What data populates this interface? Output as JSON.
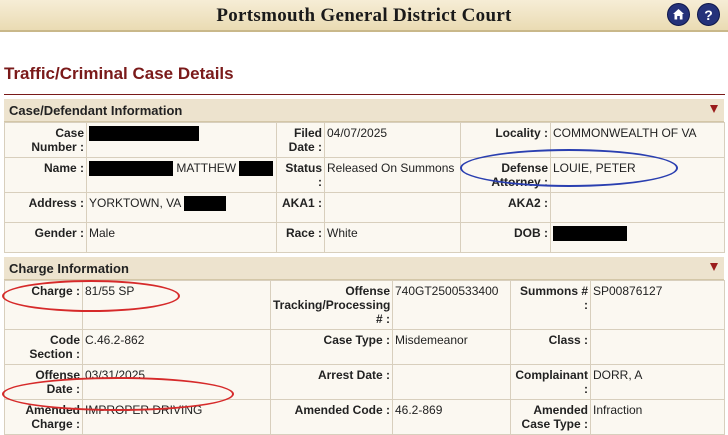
{
  "header": {
    "title": "Portsmouth General District Court",
    "home_icon": "home-icon",
    "help_icon": "help-icon",
    "help_glyph": "?"
  },
  "page": {
    "title": "Traffic/Criminal Case Details"
  },
  "case_section": {
    "heading": "Case/Defendant Information",
    "labels": {
      "case_number": "Case Number :",
      "filed_date": "Filed Date :",
      "locality": "Locality :",
      "name": "Name :",
      "status": "Status :",
      "defense_attorney": "Defense Attorney :",
      "address": "Address :",
      "aka1": "AKA1 :",
      "aka2": "AKA2 :",
      "gender": "Gender :",
      "race": "Race :",
      "dob": "DOB :"
    },
    "values": {
      "filed_date": "04/07/2025",
      "locality": "COMMONWEALTH OF VA",
      "name_first": "MATTHEW",
      "status": "Released On Summons",
      "defense_attorney": "LOUIE, PETER",
      "address": "YORKTOWN, VA",
      "aka1": "",
      "aka2": "",
      "gender": "Male",
      "race": "White"
    }
  },
  "charge_section": {
    "heading": "Charge Information",
    "labels": {
      "charge": "Charge :",
      "tracking": "Offense Tracking/Processing # :",
      "summons": "Summons # :",
      "code_section": "Code Section :",
      "case_type": "Case Type :",
      "class": "Class :",
      "offense_date": "Offense Date :",
      "arrest_date": "Arrest Date :",
      "complainant": "Complainant :",
      "amended_charge": "Amended Charge :",
      "amended_code": "Amended Code :",
      "amended_case_type": "Amended Case Type :"
    },
    "values": {
      "charge": "81/55 SP",
      "tracking": "740GT2500533400",
      "summons": "SP00876127",
      "code_section": "C.46.2-862",
      "case_type": "Misdemeanor",
      "class": "",
      "offense_date": "03/31/2025",
      "arrest_date": "",
      "complainant": "DORR, A",
      "amended_charge": "IMPROPER DRIVING",
      "amended_code": "46.2-869",
      "amended_case_type": "Infraction"
    }
  },
  "colors": {
    "accent": "#7a1a1a",
    "header_bg": "#eadbb3",
    "section_bg": "#ede3ce",
    "red_markup": "#d62a2a",
    "blue_markup": "#2a3fb0"
  }
}
